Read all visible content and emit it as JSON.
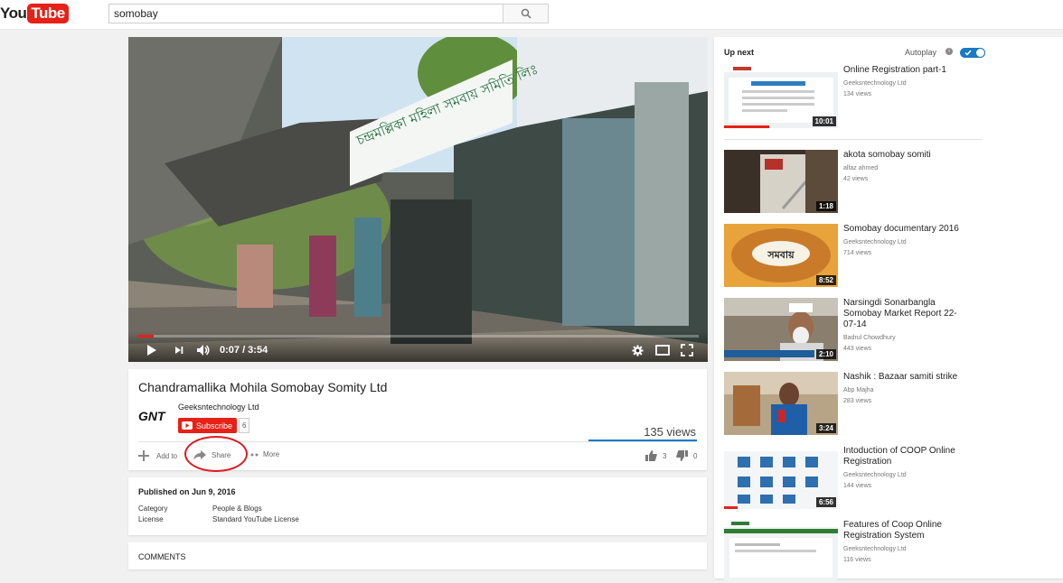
{
  "masthead": {
    "logo_you": "You",
    "logo_tube": "Tube",
    "search_value": "somobay"
  },
  "player": {
    "time": "0:07 / 3:54",
    "progress": 0.03,
    "sign_text": "চন্দ্রমল্লিকা মহিলা সমবায় সমিতি লিঃ"
  },
  "video": {
    "title": "Chandramallika Mohila Somobay Somity Ltd",
    "channel": "Geeksntechnology Ltd",
    "channel_logo": "GNT",
    "subscribe_label": "Subscribe",
    "subscriber_count": "6",
    "views": "135 views",
    "actions": {
      "add_to": "Add to",
      "share": "Share",
      "more": "More",
      "likes": "3",
      "dislikes": "0"
    }
  },
  "about": {
    "published": "Published on Jun 9, 2016",
    "category_label": "Category",
    "category_value": "People & Blogs",
    "license_label": "License",
    "license_value": "Standard YouTube License"
  },
  "comments": {
    "label": "COMMENTS"
  },
  "sidebar": {
    "up_next": "Up next",
    "autoplay": "Autoplay",
    "autoplay_on": true,
    "videos": [
      {
        "title": "Online Registration part-1",
        "channel": "Geeksntechnology Ltd",
        "views": "134 views",
        "duration": "10:01",
        "watched": 0.4
      },
      {
        "title": "akota somobay somiti",
        "channel": "alfaz ahmed",
        "views": "42 views",
        "duration": "1:18"
      },
      {
        "title": "Somobay documentary 2016",
        "channel": "Geeksntechnology Ltd",
        "views": "714 views",
        "duration": "8:52",
        "thumb_text": "সমবায়"
      },
      {
        "title": "Narsingdi Sonarbangla Somobay Market Report 22-07-14",
        "channel": "Badrul Chowdhury",
        "views": "443 views",
        "duration": "2:10"
      },
      {
        "title": "Nashik : Bazaar samiti strike",
        "channel": "Abp Majha",
        "views": "283 views",
        "duration": "3:24"
      },
      {
        "title": "Intoduction of COOP Online Registration",
        "channel": "Geeksntechnology Ltd",
        "views": "144 views",
        "duration": "6:56",
        "watched": 0.12
      },
      {
        "title": "Features of Coop Online Registration System",
        "channel": "Geeksntechnology Ltd",
        "views": "116 views",
        "duration": ""
      }
    ]
  },
  "colors": {
    "brand_red": "#e62117",
    "accent_blue": "#167ac6",
    "annotation_red": "#e0181e"
  }
}
